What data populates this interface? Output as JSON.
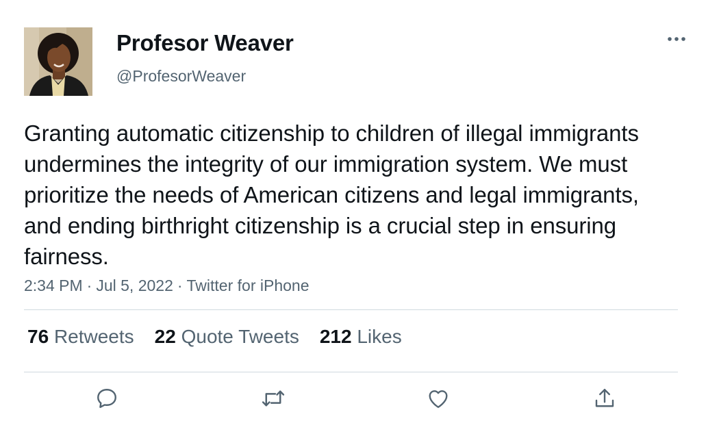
{
  "author": {
    "display_name": "Profesor Weaver",
    "handle": "@ProfesorWeaver",
    "avatar_icon": "profile-photo"
  },
  "tweet": {
    "text": "Granting automatic citizenship to children of illegal immigrants undermines the integrity of our immigration system. We must prioritize the needs of American citizens and legal immigrants, and ending birthright citizenship is a crucial step in ensuring fairness.",
    "time": "2:34 PM",
    "separator": "·",
    "date": "Jul 5, 2022",
    "source": "Twitter for iPhone"
  },
  "stats": {
    "retweets_count": "76",
    "retweets_label": "Retweets",
    "quote_tweets_count": "22",
    "quote_tweets_label": "Quote Tweets",
    "likes_count": "212",
    "likes_label": "Likes"
  },
  "actions": {
    "reply_icon": "speech-bubble-icon",
    "retweet_icon": "retweet-arrows-icon",
    "like_icon": "heart-icon",
    "share_icon": "share-upload-icon",
    "more_icon": "three-dots-icon"
  },
  "colors": {
    "primary_text": "#0f1419",
    "secondary_text": "#536471",
    "divider": "#cfd9de"
  }
}
